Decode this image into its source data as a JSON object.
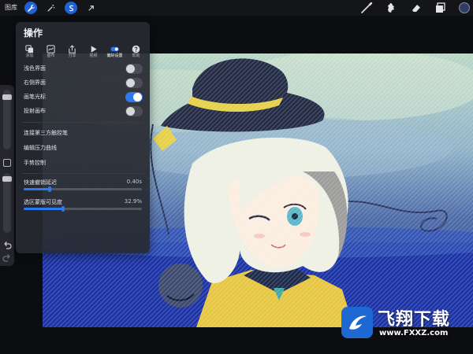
{
  "topbar": {
    "gallery_label": "图库",
    "tools_left": [
      {
        "name": "wrench-icon",
        "active": true
      },
      {
        "name": "magic-wand-icon",
        "active": false
      },
      {
        "name": "selection-s-icon",
        "active": true
      },
      {
        "name": "transform-arrow-icon",
        "active": false
      }
    ],
    "tools_right": [
      "brush-icon",
      "smudge-icon",
      "eraser-icon",
      "layers-icon"
    ],
    "current_color": "#2f3c66"
  },
  "panel": {
    "title": "操作",
    "tabs": [
      {
        "label": "添加",
        "icon": "add-icon",
        "active": false
      },
      {
        "label": "画布",
        "icon": "canvas-icon",
        "active": false
      },
      {
        "label": "分享",
        "icon": "share-icon",
        "active": false
      },
      {
        "label": "视频",
        "icon": "video-icon",
        "active": false
      },
      {
        "label": "偏好设置",
        "icon": "toggle-icon",
        "active": true
      },
      {
        "label": "帮助",
        "icon": "help-icon",
        "active": false
      }
    ],
    "toggles": [
      {
        "label": "浅色界面",
        "on": false
      },
      {
        "label": "右侧界面",
        "on": false
      },
      {
        "label": "画笔光标",
        "on": true
      },
      {
        "label": "投射画布",
        "on": false
      }
    ],
    "links": [
      "连接第三方触控笔",
      "编辑压力曲线",
      "手势控制"
    ],
    "sliders": [
      {
        "label": "快速撤销延迟",
        "value": "0.40s",
        "fraction": 0.22
      },
      {
        "label": "选区蒙版可见度",
        "value": "32.9%",
        "fraction": 0.33
      }
    ]
  },
  "watermark": {
    "text": "飞翔下载",
    "url": "www.FXXZ.com"
  },
  "colors": {
    "accent": "#2c79f0",
    "panel_bg": "#282a32",
    "toolbar_bg": "#141518"
  }
}
